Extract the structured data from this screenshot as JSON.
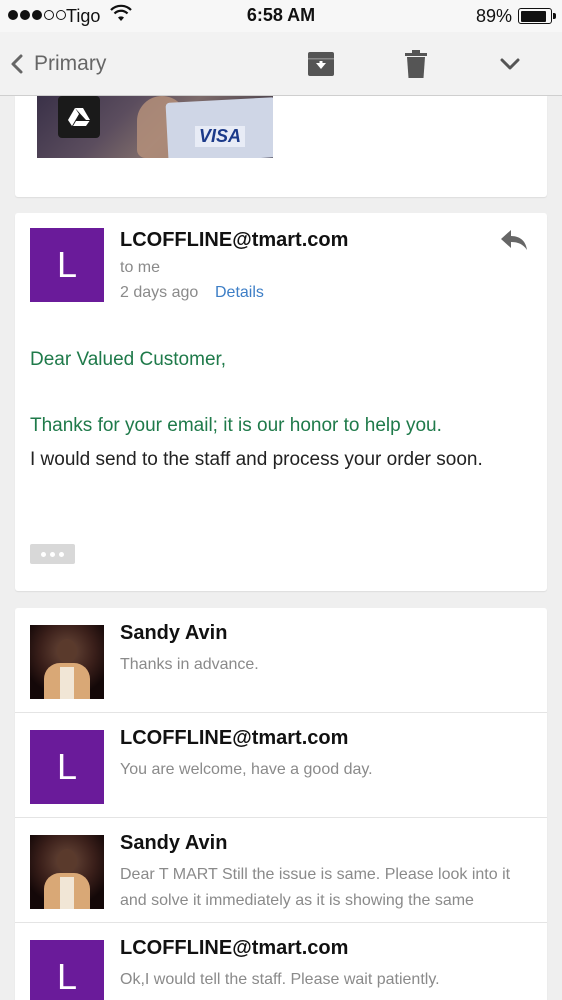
{
  "status_bar": {
    "carrier": "Tigo",
    "time": "6:58 AM",
    "battery": "89%",
    "battery_level": 0.89
  },
  "nav": {
    "back_label": "Primary",
    "icons": [
      "archive-icon",
      "trash-icon",
      "chevron-down-icon"
    ]
  },
  "message": {
    "avatar_letter": "L",
    "sender": "LCOFFLINE@tmart.com",
    "to": "to me",
    "time_ago": "2 days ago",
    "details_link": "Details",
    "greeting": "Dear Valued Customer,",
    "line1": "Thanks for your email; it is our honor to help you.",
    "line2": "I would send to the staff and process your order soon."
  },
  "thread": [
    {
      "sender": "Sandy Avin",
      "snippet": "Thanks in advance.",
      "avatar": "photo"
    },
    {
      "sender": "LCOFFLINE@tmart.com",
      "snippet": "You are welcome, have a good day.",
      "avatar": "L"
    },
    {
      "sender": "Sandy Avin",
      "snippet": "Dear T MART Still the issue is same. Please look into it and solve it immediately as it is showing the same",
      "avatar": "photo"
    },
    {
      "sender": "LCOFFLINE@tmart.com",
      "snippet": "Ok,I would tell the staff. Please wait patiently.",
      "avatar": "L"
    }
  ],
  "colors": {
    "avatar_purple": "#6a1b9a",
    "link_blue": "#3d7ec6",
    "quoted_green": "#1f7a4a"
  }
}
